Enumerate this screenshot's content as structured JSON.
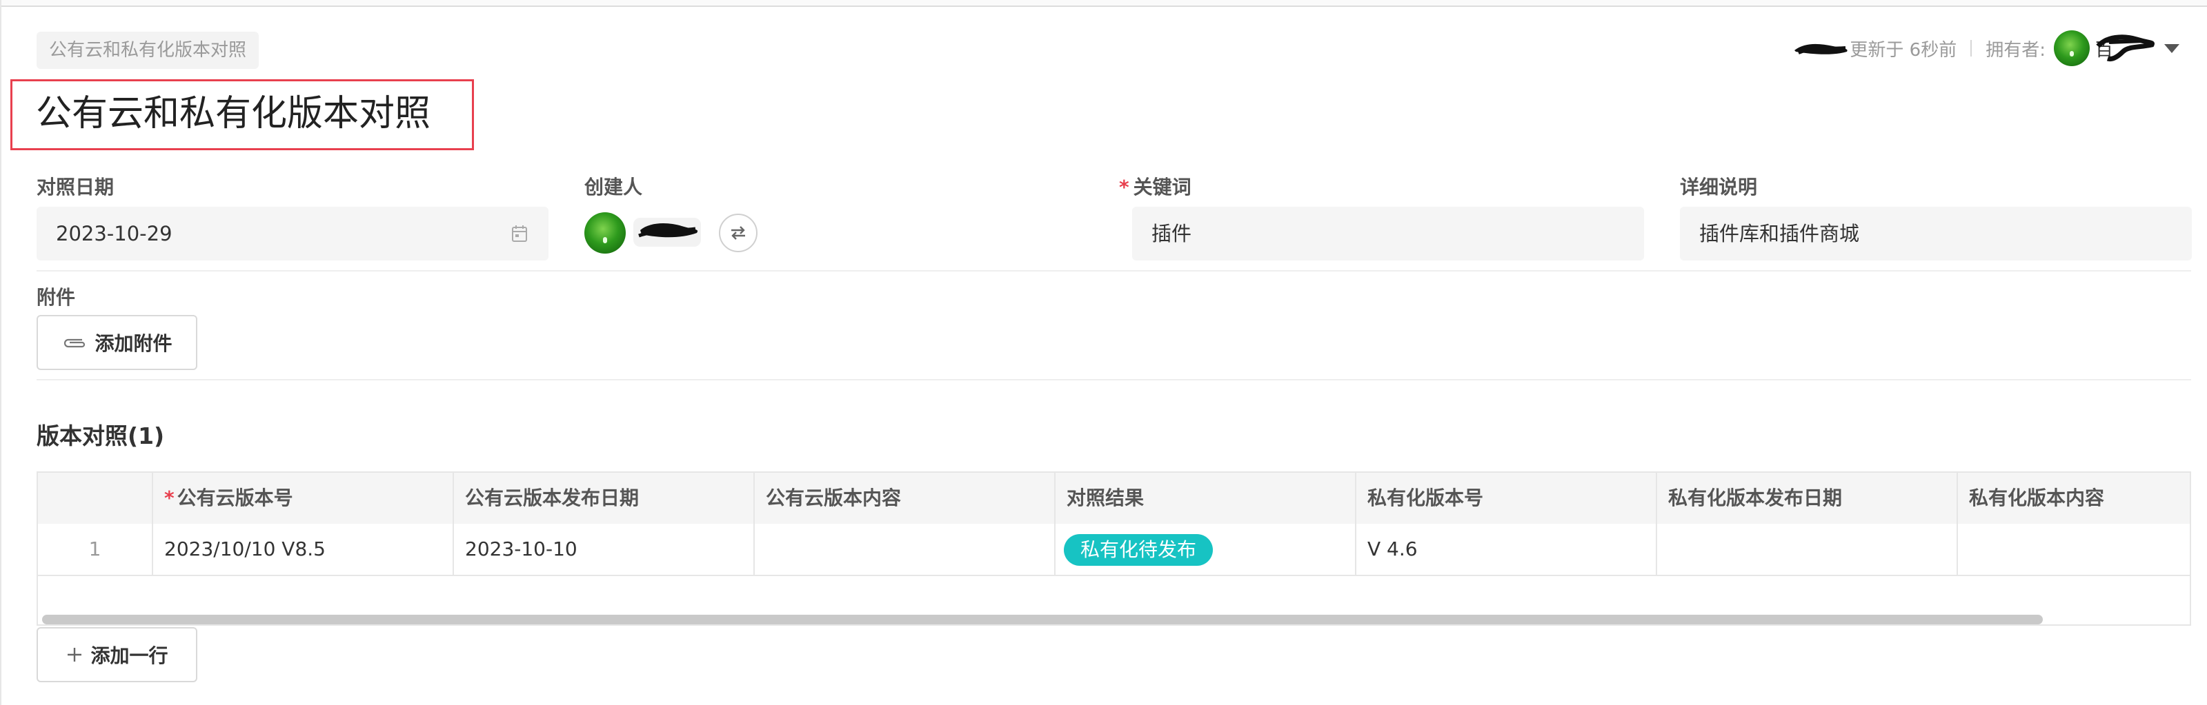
{
  "breadcrumb": {
    "label": "公有云和私有化版本对照"
  },
  "page": {
    "title": "公有云和私有化版本对照"
  },
  "header": {
    "updated": "更新于 6秒前",
    "owner_label": "拥有者:",
    "owner_name": "百"
  },
  "form": {
    "date": {
      "label": "对照日期",
      "value": "2023-10-29"
    },
    "creator": {
      "label": "创建人"
    },
    "keyword": {
      "label": "关键词",
      "required_mark": "*",
      "value": "插件"
    },
    "detail": {
      "label": "详细说明",
      "value": "插件库和插件商城"
    },
    "attachment": {
      "label": "附件",
      "button": "添加附件"
    }
  },
  "table": {
    "section_title": "版本对照(1)",
    "required_mark": "*",
    "columns": [
      "公有云版本号",
      "公有云版本发布日期",
      "公有云版本内容",
      "对照结果",
      "私有化版本号",
      "私有化版本发布日期",
      "私有化版本内容"
    ],
    "rows": [
      {
        "index": "1",
        "public_version": "2023/10/10 V8.5",
        "public_date": "2023-10-10",
        "public_content": "",
        "result": "私有化待发布",
        "private_version": "V 4.6",
        "private_date": "",
        "private_content": ""
      }
    ],
    "add_row_button": "添加一行"
  },
  "colors": {
    "accent_badge": "#17c3c3",
    "required": "#e8404e",
    "highlight_box": "#e8404e"
  }
}
